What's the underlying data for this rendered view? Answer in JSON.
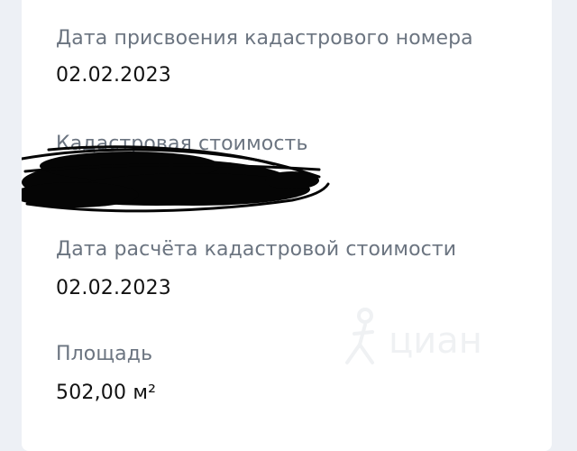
{
  "fields": [
    {
      "label": "Дата присвоения кадастрового номера",
      "value": "02.02.2023"
    },
    {
      "label": "Кадастровая стоимость",
      "value": ""
    },
    {
      "label": "Дата расчёта кадастровой стоимости",
      "value": "02.02.2023"
    },
    {
      "label": "Площадь",
      "value": "502,00 м²"
    }
  ],
  "watermark": {
    "text": "циан",
    "icon": "pin-person-icon"
  },
  "colors": {
    "background": "#edf0f5",
    "card": "#ffffff",
    "label": "#6b7480",
    "value": "#121212",
    "redaction": "#050505",
    "watermark": "#b9c2cc"
  }
}
